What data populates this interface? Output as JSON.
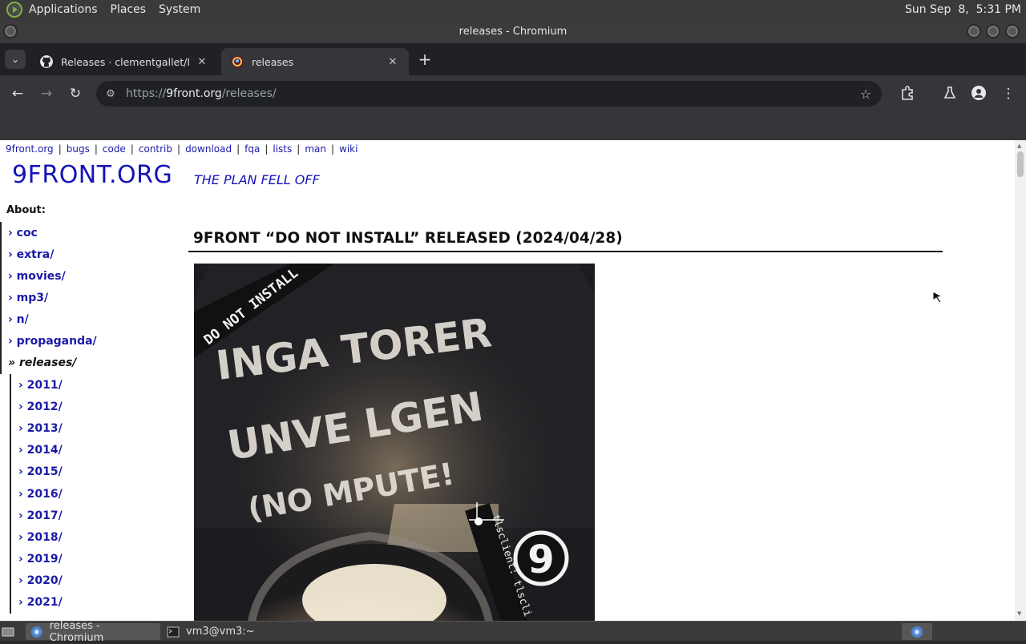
{
  "panel": {
    "menus": [
      "Applications",
      "Places",
      "System"
    ],
    "clock": "Sun Sep  8,  5:31 PM"
  },
  "window": {
    "title": "releases - Chromium"
  },
  "tabs": [
    {
      "title": "Releases · clementgallet/libT",
      "icon": "github-icon"
    },
    {
      "title": "releases",
      "icon": "9front-icon",
      "active": true
    }
  ],
  "address": {
    "scheme": "https://",
    "host": "9front.org",
    "path": "/releases/"
  },
  "page": {
    "topnav": [
      "9front.org",
      "bugs",
      "code",
      "contrib",
      "download",
      "fqa",
      "lists",
      "man",
      "wiki"
    ],
    "site_title": "9FRONT.ORG",
    "tagline": "THE PLAN FELL OFF",
    "about_label": "About:",
    "nav": [
      {
        "label": "› coc"
      },
      {
        "label": "› extra/"
      },
      {
        "label": "› movies/"
      },
      {
        "label": "› mp3/"
      },
      {
        "label": "› n/"
      },
      {
        "label": "› propaganda/"
      },
      {
        "label": "» releases/",
        "current": true
      }
    ],
    "years": [
      "› 2011/",
      "› 2012/",
      "› 2013/",
      "› 2014/",
      "› 2015/",
      "› 2016/",
      "› 2017/",
      "› 2018/",
      "› 2019/",
      "› 2020/",
      "› 2021/"
    ],
    "post_title": "9FRONT “DO NOT INSTALL” RELEASED (2024/04/28)",
    "image": {
      "banner": "DO NOT INSTALL",
      "line1": "INGA  TORER",
      "line2": "UNVE  LGEN",
      "line3": "(NO  MPUTE!",
      "side": "tlsclient: tlscli",
      "badge": "9"
    }
  },
  "taskbar": {
    "items": [
      "releases - Chromium",
      "vm3@vm3:~"
    ]
  },
  "colors": {
    "link": "#1a1aa8",
    "title_blue": "#1414b8"
  }
}
